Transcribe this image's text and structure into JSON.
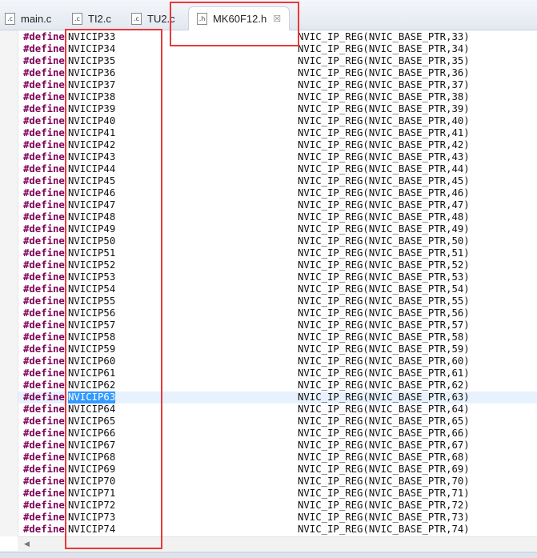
{
  "tabs": [
    {
      "label": "main.c",
      "icon": "c-file-icon",
      "icon_text": ".c"
    },
    {
      "label": "TI2.c",
      "icon": "c-file-icon",
      "icon_text": ".c"
    },
    {
      "label": "TU2.c",
      "icon": "c-file-icon",
      "icon_text": ".c"
    },
    {
      "label": "MK60F12.h",
      "icon": "h-file-icon",
      "icon_text": ".h",
      "active": true,
      "close": "☒"
    }
  ],
  "keyword": "#define",
  "highlighted": "NVICIP63",
  "rows": []
}
